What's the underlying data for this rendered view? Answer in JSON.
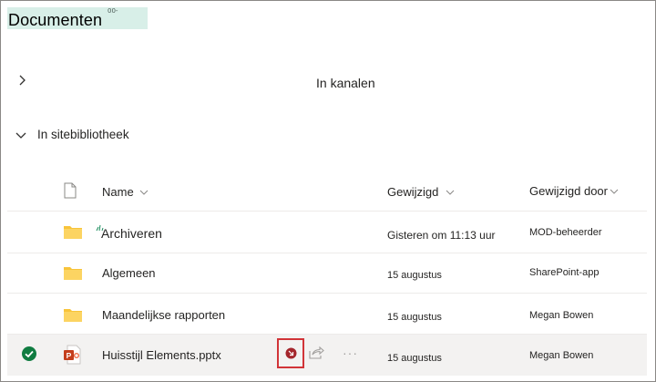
{
  "header": {
    "title": "Documenten",
    "badge": "00-"
  },
  "sections": {
    "channels_label": "In kanalen",
    "library_label": "In sitebibliotheek"
  },
  "columns": {
    "name": "Name",
    "modified": "Gewijzigd",
    "modified_by": "Gewijzigd door"
  },
  "rows": [
    {
      "name": "Archiveren",
      "modified": "Gisteren om 11:13 uur",
      "modified_by": "MOD-beheerder",
      "type": "folder"
    },
    {
      "name": "Algemeen",
      "modified": "15 augustus",
      "modified_by": "SharePoint-app",
      "type": "folder"
    },
    {
      "name": "Maandelijkse rapporten",
      "modified": "15 augustus",
      "modified_by": "Megan Bowen",
      "type": "folder"
    },
    {
      "name": "Huisstijl Elements.pptx",
      "modified": "15 augustus",
      "modified_by": "Megan Bowen",
      "type": "pptx",
      "selected": true
    }
  ],
  "row_actions": {
    "more": "···"
  },
  "colors": {
    "folder": "#f8c43a",
    "selected_check": "#107c41",
    "highlight_border": "#d13438",
    "ppt": "#c43e1c"
  },
  "icons": {
    "expand": "chevron-right-icon",
    "collapse": "chevron-down-icon",
    "file_header": "file-icon",
    "sort": "chevron-down-icon",
    "folder": "folder-icon",
    "pptx": "powerpoint-icon",
    "check": "checkmark-circle-icon",
    "sync": "sync-download-icon",
    "share": "share-icon",
    "more": "more-icon"
  }
}
